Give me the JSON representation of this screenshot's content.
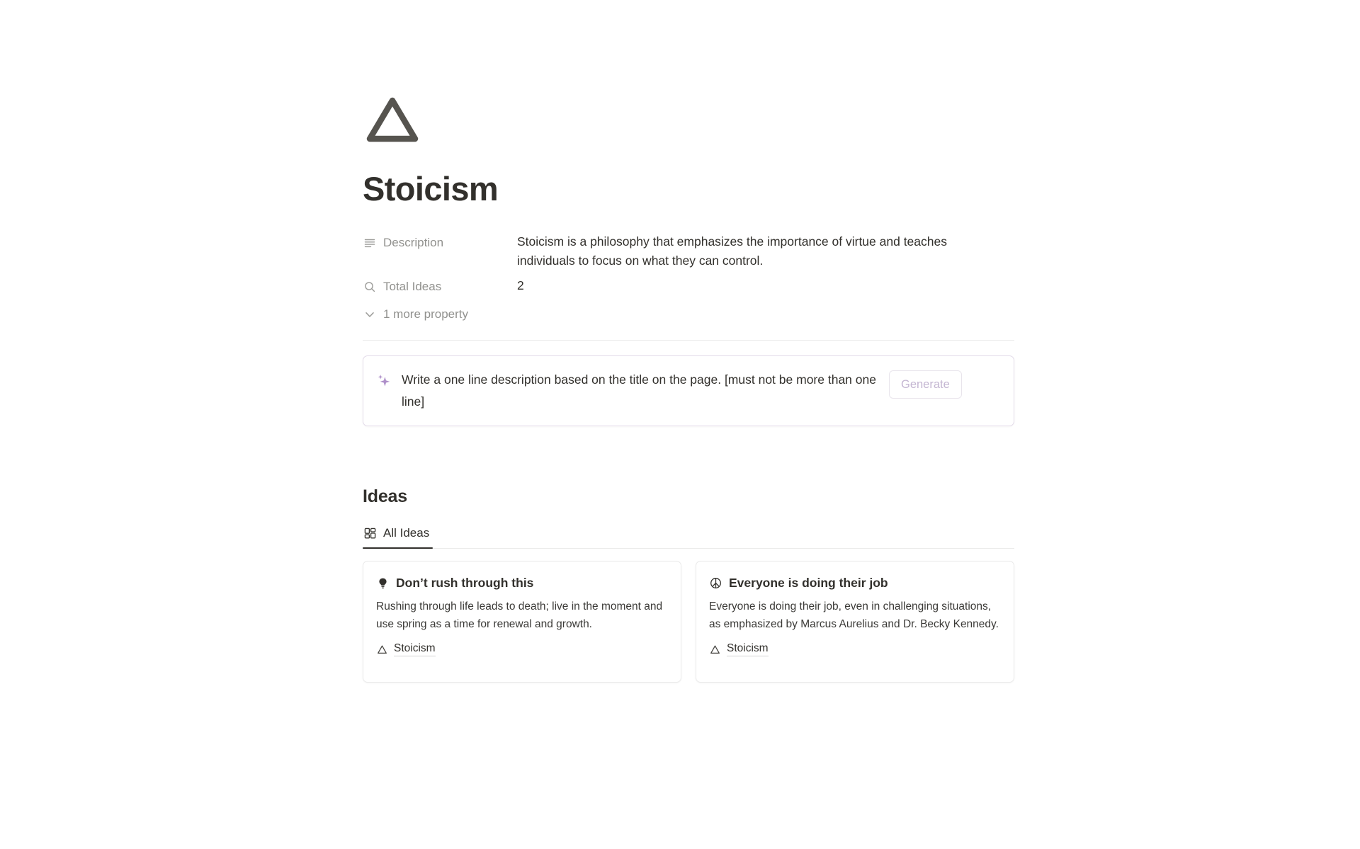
{
  "page": {
    "icon": "triangle-icon",
    "title": "Stoicism"
  },
  "properties": {
    "rows": [
      {
        "icon": "text-lines-icon",
        "label": "Description",
        "value": "Stoicism is a philosophy that emphasizes the importance of virtue and teaches individuals to focus on what they can control."
      },
      {
        "icon": "search-icon",
        "label": "Total Ideas",
        "value": "2"
      }
    ],
    "more_label": "1 more property",
    "more_icon": "chevron-down-icon"
  },
  "ai_block": {
    "icon": "sparkle-icon",
    "prompt": "Write a one line description based on the title on the page. [must not be more than one line]",
    "generate_label": "Generate",
    "accent_color": "#c4b6d2",
    "border_color": "#e3dbe9"
  },
  "ideas_section": {
    "heading": "Ideas",
    "tabs": [
      {
        "label": "All Ideas",
        "icon": "gallery-grid-icon",
        "active": true
      }
    ],
    "cards": [
      {
        "icon": "lightbulb-icon",
        "title": "Don’t rush through this",
        "description": "Rushing through life leads to death; live in the moment and use spring as a time for renewal and growth.",
        "relation_icon": "triangle-icon",
        "relation_label": "Stoicism"
      },
      {
        "icon": "peace-icon",
        "title": "Everyone is doing their job",
        "description": "Everyone is doing their job, even in challenging situations, as emphasized by Marcus Aurelius and Dr. Becky Kennedy.",
        "relation_icon": "triangle-icon",
        "relation_label": "Stoicism"
      }
    ]
  },
  "colors": {
    "text_primary": "#32302c",
    "text_muted": "#91918e",
    "divider": "#ebebea",
    "card_border": "#eaeaea"
  }
}
